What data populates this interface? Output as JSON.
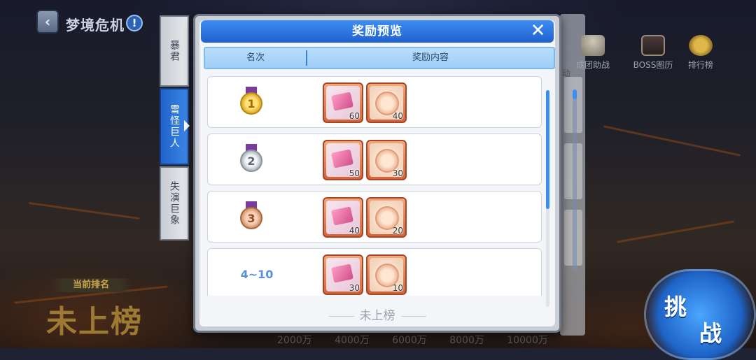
{
  "header": {
    "title": "梦境危机",
    "back_icon": "‹",
    "info_icon": "!"
  },
  "tabs": [
    {
      "label": "暴君",
      "active": false
    },
    {
      "label": "雪怪巨人",
      "active": true
    },
    {
      "label": "失演巨象",
      "active": false
    }
  ],
  "hud": {
    "items": [
      {
        "label": "成团助战",
        "icon": "group-icon"
      },
      {
        "label": "BOSS图历",
        "icon": "book-icon"
      },
      {
        "label": "排行榜",
        "icon": "trophy-icon"
      }
    ],
    "side_label": "动",
    "challenge_line1": "挑",
    "challenge_line2": "战"
  },
  "ranking": {
    "label": "当前排名",
    "value": "未上榜",
    "bottom_numbers": "2000万 4000万 6000万 8000万 10000万"
  },
  "modal": {
    "title": "奖励预览",
    "close_icon": "✕",
    "col_rank": "名次",
    "col_rewards": "奖励内容",
    "my_rank": "未上榜",
    "rows": [
      {
        "rank_type": "medal-gold",
        "rank_text": "1",
        "rewards": [
          {
            "type": "card",
            "qty": "60"
          },
          {
            "type": "gem",
            "qty": "40"
          }
        ]
      },
      {
        "rank_type": "medal-silver",
        "rank_text": "2",
        "rewards": [
          {
            "type": "card",
            "qty": "50"
          },
          {
            "type": "gem",
            "qty": "30"
          }
        ]
      },
      {
        "rank_type": "medal-bronze",
        "rank_text": "3",
        "rewards": [
          {
            "type": "card",
            "qty": "40"
          },
          {
            "type": "gem",
            "qty": "20"
          }
        ]
      },
      {
        "rank_type": "text",
        "rank_text": "4~10",
        "rewards": [
          {
            "type": "card",
            "qty": "30"
          },
          {
            "type": "gem",
            "qty": "10"
          }
        ]
      }
    ]
  },
  "colors": {
    "accent_blue": "#2060cf",
    "header_light_blue": "#9fcef7",
    "item_frame": "#d2653a"
  }
}
